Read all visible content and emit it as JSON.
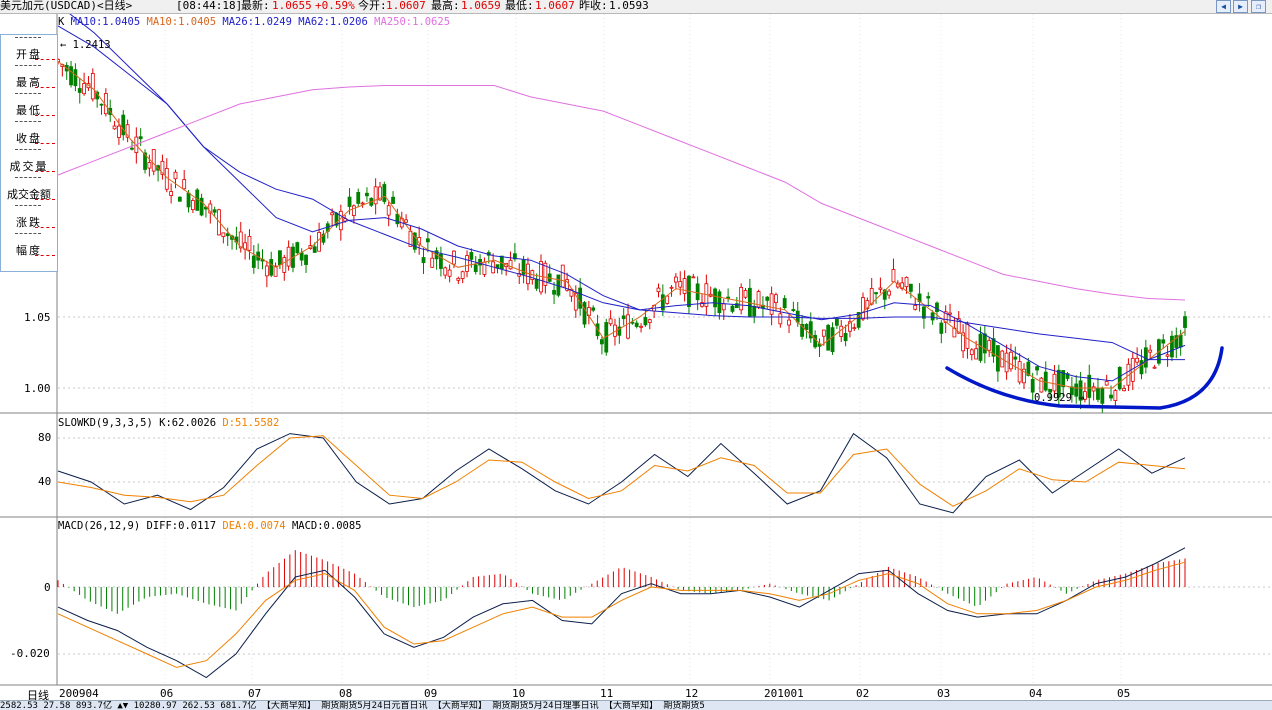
{
  "title_bar": {
    "symbol": "美元加元(USDCAD)<日线>",
    "time": "[08:44:18]",
    "latest_label": "最新:",
    "latest_value": "1.0655",
    "change": "+0.59%",
    "open_label": "今开:",
    "open_value": "1.0607",
    "high_label": "最高:",
    "high_value": "1.0659",
    "low_label": "最低:",
    "low_value": "1.0607",
    "prev_close_label": "昨收:",
    "prev_close_value": "1.0593"
  },
  "window_buttons": [
    "prev-icon",
    "next-icon",
    "restore-icon"
  ],
  "side_panel": {
    "items": [
      "开盘",
      "最高",
      "最低",
      "收盘",
      "成交量",
      "成交金额",
      "涨跌",
      "幅度"
    ]
  },
  "colors": {
    "up": "#e00000",
    "down": "#008000",
    "ma10": "#d8651c",
    "ma26": "#2020c8",
    "ma250": "#e070e0",
    "k_line": "#0a1e4a",
    "d_line": "#f08000",
    "bracket": "#0018c8"
  },
  "main_legend": {
    "prefix": "K",
    "ma10a": "MA10:1.0405",
    "ma10b": "MA10:1.0405",
    "ma26": "MA26:1.0249",
    "ma62": "MA62:1.0206",
    "ma250": "MA250:1.0625"
  },
  "kd_legend": {
    "name": "SLOWKD(9,3,3,5)",
    "k": "K:62.0026",
    "d": "D:51.5582"
  },
  "macd_legend": {
    "name": "MACD(26,12,9)",
    "diff": "DIFF:0.0117",
    "dea": "DEA:0.0074",
    "macd": "MACD:0.0085"
  },
  "annotations": {
    "high_marker": "1.2413",
    "low_marker": "0.9929"
  },
  "y_axis": {
    "main": [
      "1.05",
      "1.00"
    ],
    "kd": [
      "80",
      "40"
    ],
    "macd": [
      "0",
      "-0.020"
    ]
  },
  "x_axis": {
    "period_label": "日线",
    "ticks": [
      "200904",
      "06",
      "07",
      "08",
      "09",
      "10",
      "11",
      "12",
      "201001",
      "02",
      "03",
      "04",
      "05"
    ]
  },
  "status_bar": {
    "text": "2582.53  27.58  893.7亿  ▲▼  10280.97  262.53  681.7亿     【大商早知】 期货期货5月24日元首日讯    【大商早知】 期货期货5月24日理事日讯    【大商早知】 期货期货5"
  },
  "chart_data": [
    {
      "type": "candlestick",
      "title": "USDCAD daily",
      "y_ticks": [
        1.05,
        1.0
      ],
      "ylim": [
        0.965,
        1.3
      ],
      "series": [
        {
          "name": "MA10",
          "values": [
            1.23,
            1.21,
            1.175,
            1.148,
            1.13,
            1.1,
            1.085,
            1.1,
            1.125,
            1.135,
            1.1,
            1.085,
            1.09,
            1.08,
            1.075,
            1.035,
            1.05,
            1.07,
            1.065,
            1.06,
            1.055,
            1.03,
            1.05,
            1.075,
            1.055,
            1.035,
            1.02,
            1.005,
            1.0,
            1.0,
            1.02,
            1.04
          ]
        },
        {
          "name": "MA26",
          "values": [
            1.255,
            1.24,
            1.22,
            1.2,
            1.17,
            1.145,
            1.12,
            1.11,
            1.118,
            1.12,
            1.112,
            1.1,
            1.093,
            1.09,
            1.08,
            1.065,
            1.055,
            1.058,
            1.06,
            1.058,
            1.053,
            1.048,
            1.052,
            1.06,
            1.058,
            1.045,
            1.03,
            1.015,
            1.008,
            1.005,
            1.02,
            1.03
          ]
        },
        {
          "name": "MA62",
          "values": [
            1.27,
            1.25,
            1.225,
            1.2,
            1.17,
            1.152,
            1.14,
            1.133,
            1.118,
            1.108,
            1.098,
            1.092,
            1.085,
            1.078,
            1.07,
            1.06,
            1.055,
            1.053,
            1.051,
            1.05,
            1.05,
            1.049,
            1.049,
            1.05,
            1.05,
            1.046,
            1.042,
            1.038,
            1.035,
            1.032,
            1.02,
            1.02
          ]
        },
        {
          "name": "MA250",
          "values": [
            1.15,
            1.16,
            1.17,
            1.18,
            1.19,
            1.2,
            1.205,
            1.21,
            1.212,
            1.213,
            1.213,
            1.213,
            1.213,
            1.205,
            1.2,
            1.195,
            1.185,
            1.175,
            1.165,
            1.155,
            1.145,
            1.13,
            1.12,
            1.11,
            1.1,
            1.09,
            1.08,
            1.075,
            1.07,
            1.066,
            1.063,
            1.062
          ]
        }
      ]
    },
    {
      "type": "line",
      "title": "SLOWKD(9,3,3,5)",
      "y_ticks": [
        80,
        40
      ],
      "ylim": [
        0,
        100
      ],
      "series": [
        {
          "name": "K",
          "values": [
            50,
            40,
            20,
            28,
            15,
            35,
            70,
            84,
            80,
            40,
            20,
            25,
            50,
            70,
            52,
            32,
            20,
            40,
            65,
            45,
            75,
            48,
            20,
            32,
            84,
            62,
            20,
            12,
            45,
            60,
            30,
            50,
            70,
            48,
            62
          ]
        },
        {
          "name": "D",
          "values": [
            40,
            35,
            28,
            26,
            22,
            28,
            55,
            80,
            82,
            55,
            28,
            25,
            40,
            60,
            58,
            40,
            25,
            32,
            55,
            50,
            62,
            55,
            30,
            30,
            65,
            70,
            38,
            18,
            32,
            52,
            42,
            40,
            58,
            55,
            52
          ]
        }
      ]
    },
    {
      "type": "bar",
      "title": "MACD(26,12,9)",
      "y_ticks": [
        0,
        -0.02
      ],
      "ylim": [
        -0.03,
        0.015
      ],
      "series": [
        {
          "name": "MACD",
          "values": [
            0.002,
            -0.004,
            -0.008,
            -0.003,
            -0.002,
            -0.005,
            -0.007,
            0.004,
            0.011,
            0.008,
            0.004,
            -0.003,
            -0.006,
            -0.004,
            0.003,
            0.004,
            -0.002,
            -0.004,
            0.001,
            0.006,
            0.003,
            -0.001,
            -0.002,
            -0.001,
            0.001,
            -0.002,
            -0.004,
            0.001,
            0.006,
            0.003,
            -0.002,
            -0.006,
            0.001,
            0.003,
            -0.002,
            0.002,
            0.004,
            0.007,
            0.0085
          ]
        },
        {
          "name": "DIFF",
          "values": [
            -0.006,
            -0.01,
            -0.013,
            -0.018,
            -0.022,
            -0.027,
            -0.02,
            -0.008,
            0.003,
            0.005,
            -0.003,
            -0.014,
            -0.018,
            -0.015,
            -0.009,
            -0.005,
            -0.004,
            -0.01,
            -0.011,
            -0.002,
            0.001,
            -0.002,
            -0.002,
            -0.001,
            -0.003,
            -0.006,
            -0.001,
            0.004,
            0.005,
            -0.002,
            -0.007,
            -0.009,
            -0.008,
            -0.008,
            -0.004,
            0.001,
            0.003,
            0.007,
            0.0117
          ]
        },
        {
          "name": "DEA",
          "values": [
            -0.008,
            -0.012,
            -0.016,
            -0.02,
            -0.024,
            -0.022,
            -0.014,
            -0.004,
            0.002,
            0.004,
            -0.001,
            -0.012,
            -0.017,
            -0.016,
            -0.012,
            -0.008,
            -0.006,
            -0.009,
            -0.009,
            -0.004,
            0.0,
            -0.001,
            -0.001,
            -0.001,
            -0.002,
            -0.004,
            -0.002,
            0.002,
            0.004,
            0.001,
            -0.005,
            -0.008,
            -0.008,
            -0.007,
            -0.004,
            0.0,
            0.002,
            0.005,
            0.0074
          ]
        }
      ]
    }
  ]
}
